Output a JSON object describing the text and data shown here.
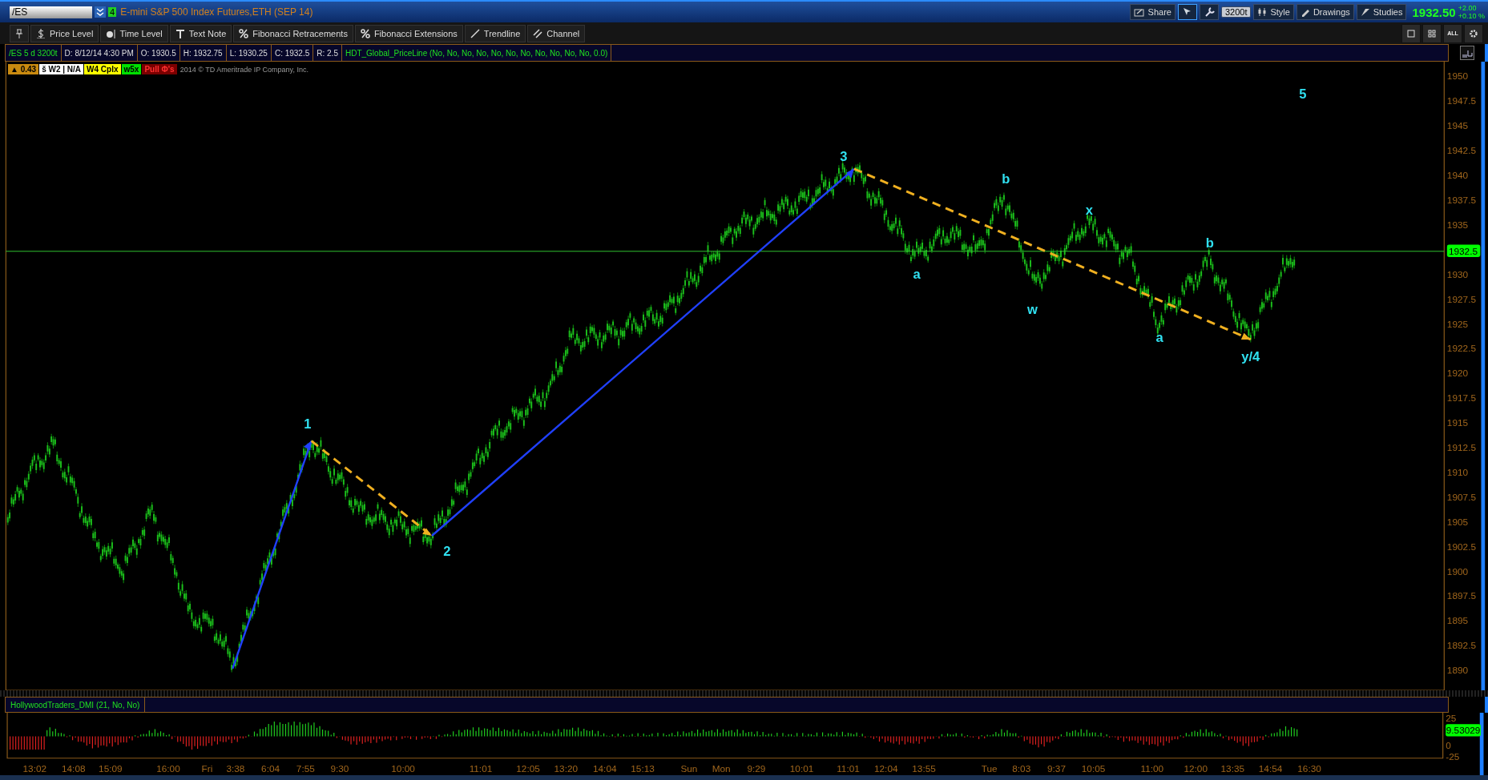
{
  "header": {
    "symbol": "/ES",
    "badge": "4",
    "title": "E-mini S&P 500 Index Futures,ETH (SEP 14)",
    "buttons": [
      {
        "kind": "share",
        "label": "Share"
      },
      {
        "kind": "cursor",
        "selected": true
      },
      {
        "kind": "wrench",
        "selected": false
      },
      {
        "kind": "chip",
        "label": "3200t"
      },
      {
        "kind": "style",
        "label": "Style"
      },
      {
        "kind": "drawings",
        "label": "Drawings"
      },
      {
        "kind": "studies",
        "label": "Studies"
      }
    ],
    "price": "1932.50",
    "change": "+2.00",
    "change_pct": "+0.10 %"
  },
  "toolbar": {
    "tools": [
      {
        "kind": "pin"
      },
      {
        "kind": "dollar",
        "label": "Price Level"
      },
      {
        "kind": "clock",
        "label": "Time Level"
      },
      {
        "kind": "text",
        "label": "Text Note"
      },
      {
        "kind": "percent",
        "label": "Fibonacci Retracements"
      },
      {
        "kind": "percent2",
        "label": "Fibonacci Extensions"
      },
      {
        "kind": "line",
        "label": "Trendline"
      },
      {
        "kind": "channel",
        "label": "Channel"
      }
    ],
    "layout_buttons": [
      {
        "kind": "single"
      },
      {
        "kind": "grid"
      },
      {
        "kind": "all",
        "label": "ALL"
      },
      {
        "kind": "gear"
      }
    ]
  },
  "info": {
    "cells": [
      "/ES 5 d 3200t",
      "D: 8/12/14 4:30 PM",
      "O: 1930.5",
      "H: 1932.75",
      "L: 1930.25",
      "C: 1932.5",
      "R: 2.5"
    ],
    "study": "HDT_Global_PriceLine (No, No, No, No, No, No, No, No, No, No, No, 0.0)"
  },
  "badges": [
    {
      "text": "▲ 0.43",
      "color": "#c98a10"
    },
    {
      "text": "š W2 | N/A",
      "color": "#ffffff"
    },
    {
      "text": "W4 Cplx",
      "color": "#ffff00"
    },
    {
      "text": "w5x",
      "color": "#00e000"
    },
    {
      "text": "Pull Φ's",
      "color": "#7a0000"
    }
  ],
  "copyright": "2014 © TD Ameritrade IP Company, Inc.",
  "wave_labels": [
    "1",
    "2",
    "3",
    "a",
    "b",
    "w",
    "x",
    "a",
    "b",
    "y/4",
    "5"
  ],
  "price_axis": [
    "1950",
    "1947.5",
    "1945",
    "1942.5",
    "1940",
    "1937.5",
    "1935",
    "1930",
    "1927.5",
    "1925",
    "1922.5",
    "1920",
    "1917.5",
    "1915",
    "1912.5",
    "1910",
    "1907.5",
    "1905",
    "1902.5",
    "1900",
    "1897.5",
    "1895",
    "1892.5",
    "1890"
  ],
  "last_price": "1932.5",
  "study": {
    "title": "HollywoodTraders_DMI (21, No, No)",
    "axis": [
      "25",
      "0",
      "-25"
    ],
    "value": "9.53029"
  },
  "time_axis": [
    "13:02",
    "14:08",
    "15:09",
    "16:00",
    "Fri",
    "3:38",
    "6:04",
    "7:55",
    "9:30",
    "10:00",
    "11:01",
    "12:05",
    "13:20",
    "14:04",
    "15:13",
    "Sun",
    "Mon",
    "9:29",
    "10:01",
    "11:01",
    "12:04",
    "13:55",
    "Tue",
    "8:03",
    "9:37",
    "10:05",
    "11:00",
    "12:00",
    "13:35",
    "14:54",
    "16:30"
  ]
}
